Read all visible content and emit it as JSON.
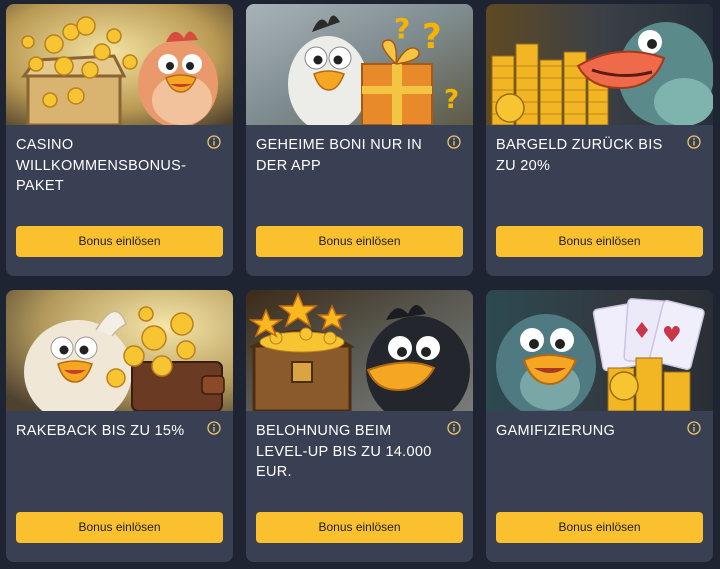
{
  "colors": {
    "page_bg": "#1f2433",
    "card_bg": "#3a4053",
    "button_bg": "#fbc02d",
    "info_icon": "#e9c46a"
  },
  "cards": [
    {
      "title": "CASINO WILLKOMMENSBONUS-PAKET",
      "button_label": "Bonus einlösen",
      "illustration": "chicken-with-treasure-chest",
      "info_icon": "info-icon"
    },
    {
      "title": "GEHEIME BONI NUR IN DER APP",
      "button_label": "Bonus einlösen",
      "illustration": "bird-with-gift-box-and-question-marks",
      "info_icon": "info-icon"
    },
    {
      "title": "BARGELD ZURÜCK BIS ZU 20%",
      "button_label": "Bonus einlösen",
      "illustration": "bird-with-coin-stacks",
      "info_icon": "info-icon"
    },
    {
      "title": "RAKEBACK BIS ZU 15%",
      "button_label": "Bonus einlösen",
      "illustration": "chicken-with-wallet-and-coins",
      "info_icon": "info-icon"
    },
    {
      "title": "BELOHNUNG BEIM LEVEL-UP BIS ZU 14.000 EUR.",
      "button_label": "Bonus einlösen",
      "illustration": "crow-with-treasure-chest-and-stars",
      "info_icon": "info-icon"
    },
    {
      "title": "GAMIFIZIERUNG",
      "button_label": "Bonus einlösen",
      "illustration": "bird-with-playing-cards-and-coins",
      "info_icon": "info-icon"
    }
  ]
}
